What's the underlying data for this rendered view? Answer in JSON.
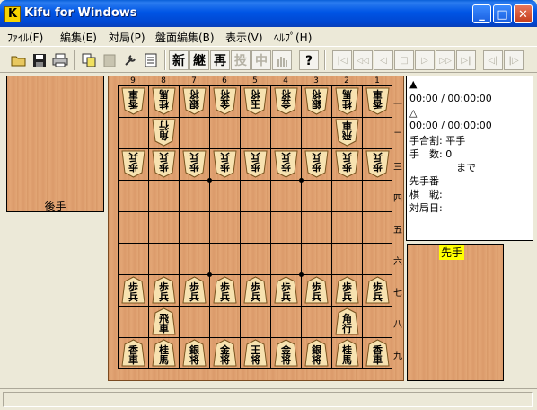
{
  "window": {
    "title": "Kifu for Windows",
    "app_icon_letter": "K",
    "minimize_symbol": "_",
    "maximize_symbol": "□",
    "close_symbol": "✕"
  },
  "menu": {
    "items": [
      {
        "label": "ﾌｧｲﾙ(F)"
      },
      {
        "label": "編集(E)"
      },
      {
        "label": "対局(P)"
      },
      {
        "label": "盤面編集(B)"
      },
      {
        "label": "表示(V)"
      },
      {
        "label": "ﾍﾙﾌﾟ(H)"
      }
    ]
  },
  "toolbar": {
    "open_icon": "folder-open-icon",
    "save_icon": "floppy-save-icon",
    "print_icon": "printer-icon",
    "copy_icon": "copy-icon",
    "paste_icon": "paste-icon",
    "settings_icon": "wrench-icon",
    "notes_icon": "notes-icon",
    "new_label": "新",
    "continue_label": "継",
    "replay_label": "再",
    "resign_label": "投",
    "suspend_label": "中",
    "wait_icon": "hand-icon",
    "help_label": "?",
    "nav_first": "|◁",
    "nav_back_many": "◁◁",
    "nav_prev": "◁",
    "nav_stop": "□",
    "nav_next": "▷",
    "nav_fwd_many": "▷▷",
    "nav_last": "▷|",
    "branch_prev": "◁|",
    "branch_next": "|▷"
  },
  "board": {
    "column_numbers": [
      "9",
      "8",
      "7",
      "6",
      "5",
      "4",
      "3",
      "2",
      "1"
    ],
    "row_numbers": [
      "一",
      "二",
      "三",
      "四",
      "五",
      "六",
      "七",
      "八",
      "九"
    ],
    "pieces": [
      {
        "row": 1,
        "col": 1,
        "text": "香車",
        "side": "gote"
      },
      {
        "row": 1,
        "col": 2,
        "text": "桂馬",
        "side": "gote"
      },
      {
        "row": 1,
        "col": 3,
        "text": "銀将",
        "side": "gote"
      },
      {
        "row": 1,
        "col": 4,
        "text": "金将",
        "side": "gote"
      },
      {
        "row": 1,
        "col": 5,
        "text": "玉将",
        "side": "gote"
      },
      {
        "row": 1,
        "col": 6,
        "text": "金将",
        "side": "gote"
      },
      {
        "row": 1,
        "col": 7,
        "text": "銀将",
        "side": "gote"
      },
      {
        "row": 1,
        "col": 8,
        "text": "桂馬",
        "side": "gote"
      },
      {
        "row": 1,
        "col": 9,
        "text": "香車",
        "side": "gote"
      },
      {
        "row": 2,
        "col": 2,
        "text": "飛車",
        "side": "gote"
      },
      {
        "row": 2,
        "col": 8,
        "text": "角行",
        "side": "gote"
      },
      {
        "row": 3,
        "col": 1,
        "text": "歩兵",
        "side": "gote"
      },
      {
        "row": 3,
        "col": 2,
        "text": "歩兵",
        "side": "gote"
      },
      {
        "row": 3,
        "col": 3,
        "text": "歩兵",
        "side": "gote"
      },
      {
        "row": 3,
        "col": 4,
        "text": "歩兵",
        "side": "gote"
      },
      {
        "row": 3,
        "col": 5,
        "text": "歩兵",
        "side": "gote"
      },
      {
        "row": 3,
        "col": 6,
        "text": "歩兵",
        "side": "gote"
      },
      {
        "row": 3,
        "col": 7,
        "text": "歩兵",
        "side": "gote"
      },
      {
        "row": 3,
        "col": 8,
        "text": "歩兵",
        "side": "gote"
      },
      {
        "row": 3,
        "col": 9,
        "text": "歩兵",
        "side": "gote"
      },
      {
        "row": 7,
        "col": 1,
        "text": "歩兵",
        "side": "sente"
      },
      {
        "row": 7,
        "col": 2,
        "text": "歩兵",
        "side": "sente"
      },
      {
        "row": 7,
        "col": 3,
        "text": "歩兵",
        "side": "sente"
      },
      {
        "row": 7,
        "col": 4,
        "text": "歩兵",
        "side": "sente"
      },
      {
        "row": 7,
        "col": 5,
        "text": "歩兵",
        "side": "sente"
      },
      {
        "row": 7,
        "col": 6,
        "text": "歩兵",
        "side": "sente"
      },
      {
        "row": 7,
        "col": 7,
        "text": "歩兵",
        "side": "sente"
      },
      {
        "row": 7,
        "col": 8,
        "text": "歩兵",
        "side": "sente"
      },
      {
        "row": 7,
        "col": 9,
        "text": "歩兵",
        "side": "sente"
      },
      {
        "row": 8,
        "col": 2,
        "text": "角行",
        "side": "sente"
      },
      {
        "row": 8,
        "col": 8,
        "text": "飛車",
        "side": "sente"
      },
      {
        "row": 9,
        "col": 1,
        "text": "香車",
        "side": "sente"
      },
      {
        "row": 9,
        "col": 2,
        "text": "桂馬",
        "side": "sente"
      },
      {
        "row": 9,
        "col": 3,
        "text": "銀将",
        "side": "sente"
      },
      {
        "row": 9,
        "col": 4,
        "text": "金将",
        "side": "sente"
      },
      {
        "row": 9,
        "col": 5,
        "text": "王将",
        "side": "sente"
      },
      {
        "row": 9,
        "col": 6,
        "text": "金将",
        "side": "sente"
      },
      {
        "row": 9,
        "col": 7,
        "text": "銀将",
        "side": "sente"
      },
      {
        "row": 9,
        "col": 8,
        "text": "桂馬",
        "side": "sente"
      },
      {
        "row": 9,
        "col": 9,
        "text": "香車",
        "side": "sente"
      }
    ]
  },
  "komadai": {
    "gote_label": "後手",
    "sente_label": "先手"
  },
  "info": {
    "gote_mark": "▲",
    "gote_time": "00:00 / 00:00:00",
    "sente_mark": "△",
    "sente_time": "00:00 / 00:00:00",
    "handicap": "手合割: 平手",
    "move_count": "手　数:  0",
    "made": "まで",
    "sente_ban": "先手番",
    "event": "棋　戦:",
    "date": "対局日:"
  },
  "colors": {
    "title_bar": "#0055e5",
    "board_wood": "#dfa070",
    "piece_face": "#f7e2b0",
    "sente_badge": "#ffff00"
  }
}
